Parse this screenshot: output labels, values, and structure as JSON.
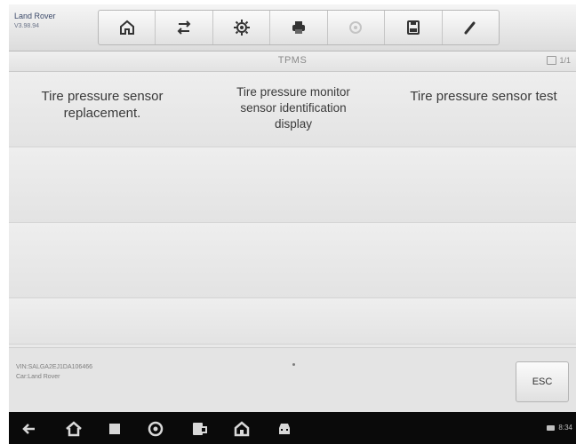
{
  "vehicle": {
    "make": "Land Rover",
    "version": "V3.98.94"
  },
  "toolbar": {
    "buttons": [
      {
        "name": "home-icon"
      },
      {
        "name": "vehicle-swap-icon"
      },
      {
        "name": "settings-icon"
      },
      {
        "name": "print-icon"
      },
      {
        "name": "help-icon",
        "disabled": true
      },
      {
        "name": "save-icon"
      },
      {
        "name": "data-logging-icon"
      }
    ]
  },
  "titlebar": {
    "title": "TPMS",
    "page": "1/1"
  },
  "functions": [
    "Tire pressure sensor replacement.",
    "Tire pressure monitor sensor identification display",
    "Tire pressure sensor test"
  ],
  "info": {
    "vin": "VIN:SALGA2EJ1DA106466",
    "model": "Car:Land Rover",
    "esc_label": "ESC"
  },
  "statusbar": {
    "time": "8:34"
  },
  "navbar": {
    "icons": [
      "back-icon",
      "home-icon",
      "recent-apps-icon",
      "autel-icon",
      "vci-icon",
      "maxisys-home-icon",
      "vehicle-icon"
    ]
  }
}
